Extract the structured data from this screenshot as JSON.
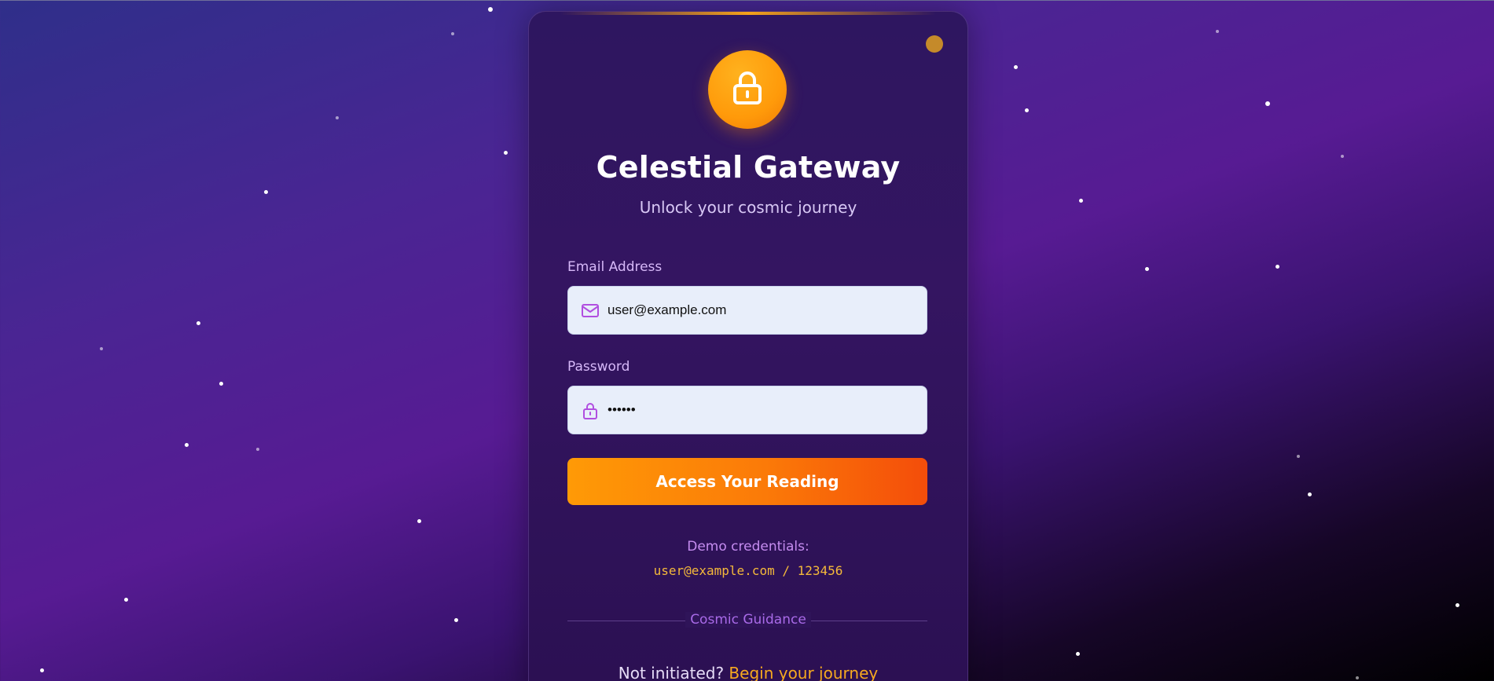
{
  "app": {
    "title": "Celestial Gateway",
    "subtitle": "Unlock your cosmic journey"
  },
  "form": {
    "email": {
      "label": "Email Address",
      "value": "user@example.com",
      "icon": "mail-icon"
    },
    "password": {
      "label": "Password",
      "value": "123456",
      "icon": "lock-icon"
    },
    "submit_label": "Access Your Reading"
  },
  "demo": {
    "label": "Demo credentials:",
    "credentials": "user@example.com / 123456"
  },
  "divider_text": "Cosmic Guidance",
  "signup": {
    "prompt": "Not initiated?",
    "link_label": "Begin your journey"
  },
  "colors": {
    "accent": "#ff9a06",
    "accent_end": "#f44d0a",
    "link": "#f7a91f",
    "label": "#d6b8f8"
  },
  "logo_icon": "lock-icon"
}
